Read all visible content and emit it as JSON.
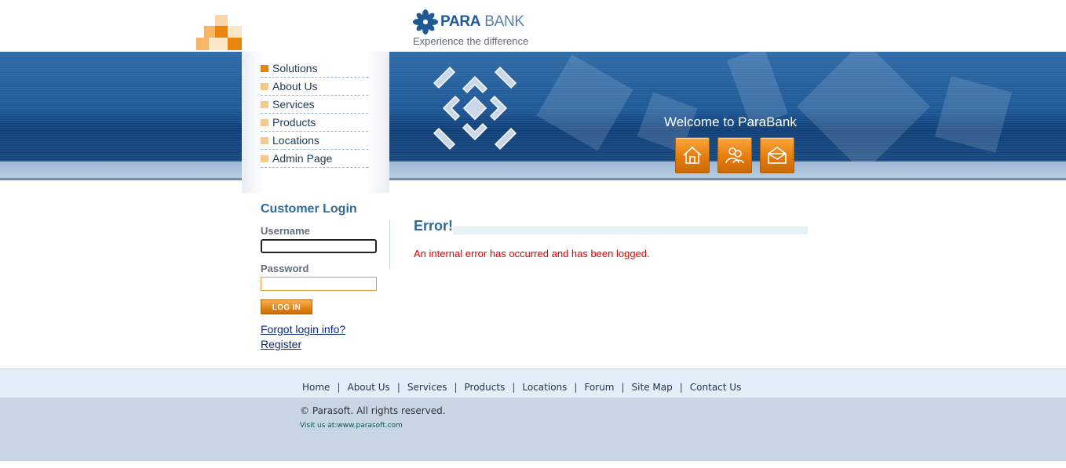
{
  "brand": {
    "name_part1": "PARA",
    "name_part2": " BANK",
    "tagline": "Experience the difference",
    "logo_icon": "parabank-flower-logo-icon"
  },
  "nav": {
    "items": [
      {
        "label": "Solutions",
        "active": true
      },
      {
        "label": "About Us",
        "active": false
      },
      {
        "label": "Services",
        "active": false
      },
      {
        "label": "Products",
        "active": false
      },
      {
        "label": "Locations",
        "active": false
      },
      {
        "label": "Admin Page",
        "active": false
      }
    ]
  },
  "banner": {
    "welcome": "Welcome to ParaBank",
    "buttons": [
      {
        "icon": "home-icon"
      },
      {
        "icon": "about-people-icon"
      },
      {
        "icon": "contact-envelope-icon"
      }
    ]
  },
  "login": {
    "title": "Customer Login",
    "username_label": "Username",
    "username_value": "",
    "password_label": "Password",
    "password_value": "",
    "button_label": "LOG IN",
    "forgot_link": "Forgot login info?",
    "register_link": "Register"
  },
  "main": {
    "title": "Error!",
    "message": "An internal error has occurred and has been logged."
  },
  "footer": {
    "links": [
      "Home",
      "About Us",
      "Services",
      "Products",
      "Locations",
      "Forum",
      "Site Map",
      "Contact Us"
    ],
    "separator": "|",
    "copyright": "© Parasoft. All rights reserved.",
    "visit_prefix": "Visit us at:",
    "visit_link": "www.parasoft.com"
  },
  "colors": {
    "accent_orange": "#e8850e",
    "brand_blue": "#2f6a98",
    "error_red": "#e00000",
    "banner_blue": "#1d5896"
  }
}
